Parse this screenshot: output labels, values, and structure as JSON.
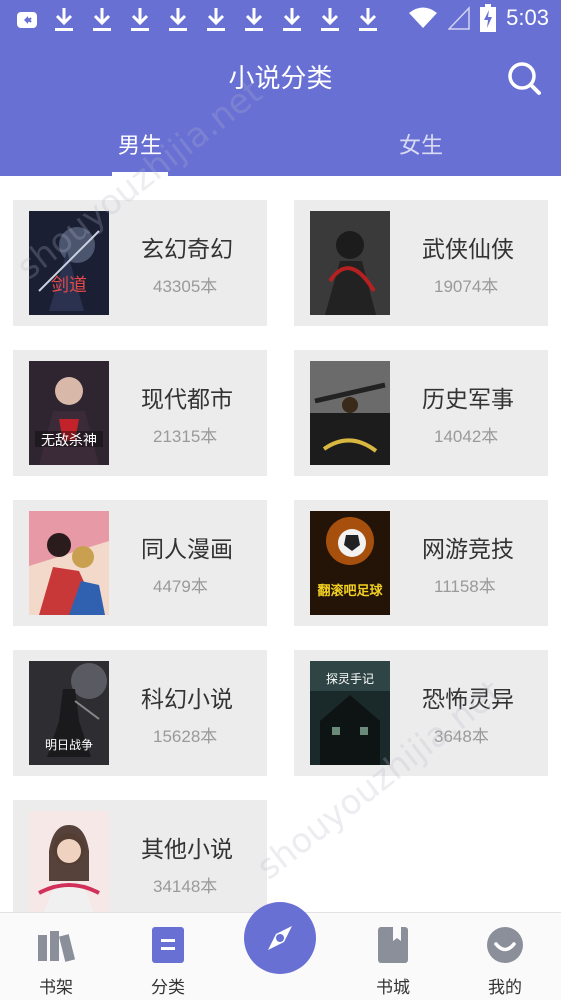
{
  "app": {
    "title": "小说分类",
    "accent": "#6870d4"
  },
  "statusbar": {
    "time": "5:03",
    "icons": [
      "notification-icon",
      "download-icon",
      "wifi-icon",
      "signal-icon",
      "battery-charging-icon"
    ]
  },
  "tabs": [
    {
      "label": "男生",
      "active": true
    },
    {
      "label": "女生",
      "active": false
    }
  ],
  "categories": [
    {
      "name": "玄幻奇幻",
      "count": "43305本"
    },
    {
      "name": "武侠仙侠",
      "count": "19074本"
    },
    {
      "name": "现代都市",
      "count": "21315本"
    },
    {
      "name": "历史军事",
      "count": "14042本"
    },
    {
      "name": "同人漫画",
      "count": "4479本"
    },
    {
      "name": "网游竞技",
      "count": "11158本"
    },
    {
      "name": "科幻小说",
      "count": "15628本"
    },
    {
      "name": "恐怖灵异",
      "count": "3648本"
    },
    {
      "name": "其他小说",
      "count": "34148本"
    }
  ],
  "covers": {
    "c0": "剑道",
    "c2": "无敌杀神",
    "c5": "翻滚吧足球",
    "c6": "明日战争",
    "c7": "探灵手记"
  },
  "watermark": {
    "text1": "shouyouzhijia.net",
    "text2": "shouyouzhijia.net"
  },
  "bottomnav": {
    "items": [
      {
        "label": "书架",
        "icon": "bookshelf-icon"
      },
      {
        "label": "分类",
        "icon": "category-icon"
      },
      {
        "label": "书城",
        "icon": "bookstore-icon"
      },
      {
        "label": "我的",
        "icon": "profile-icon"
      }
    ],
    "center_icon": "compass-icon"
  }
}
